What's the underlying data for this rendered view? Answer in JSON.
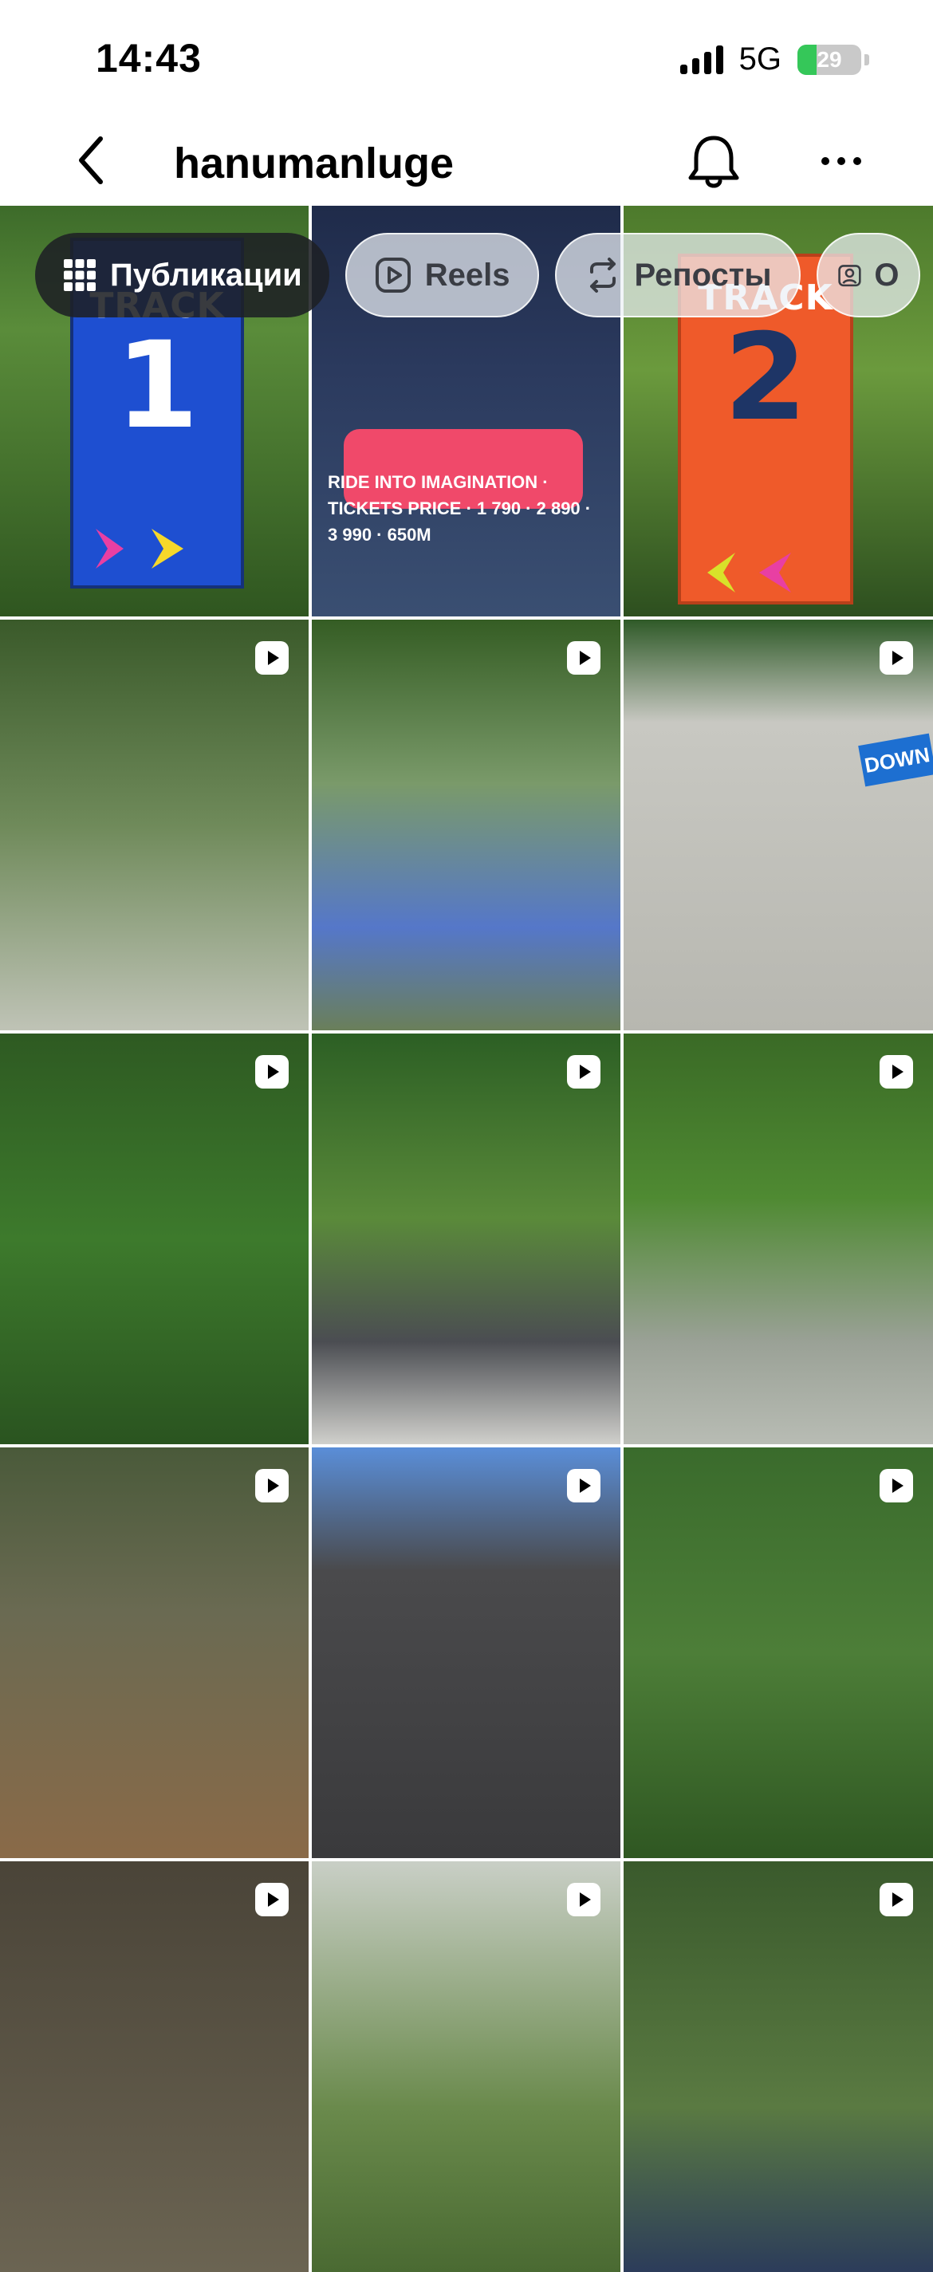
{
  "status_bar": {
    "time": "14:43",
    "network": "5G",
    "battery_percent": "29"
  },
  "nav": {
    "title": "hanumanluge",
    "back_icon": "chevron-left-icon",
    "bell_icon": "bell-icon",
    "more_icon": "ellipsis-icon"
  },
  "tabs": [
    {
      "label": "Публикации",
      "icon": "grid-icon",
      "active": true
    },
    {
      "label": "Reels",
      "icon": "reels-icon",
      "active": false
    },
    {
      "label": "Репосты",
      "icon": "repost-icon",
      "active": false
    },
    {
      "label": "О",
      "icon": "tagged-icon",
      "active": false
    }
  ],
  "tiles": [
    {
      "kind": "image",
      "text_word": "TRACK",
      "text_num": "1"
    },
    {
      "kind": "image",
      "text": "RIDE INTO IMAGINATION · TICKETS PRICE · 1 790 · 2 890 · 3 990 · 650M"
    },
    {
      "kind": "image",
      "text_word": "TRACK",
      "text_num": "2"
    },
    {
      "kind": "reel"
    },
    {
      "kind": "reel"
    },
    {
      "kind": "reel",
      "text": "DOWN"
    },
    {
      "kind": "reel"
    },
    {
      "kind": "reel"
    },
    {
      "kind": "reel"
    },
    {
      "kind": "reel"
    },
    {
      "kind": "reel"
    },
    {
      "kind": "reel"
    },
    {
      "kind": "reel"
    },
    {
      "kind": "reel"
    },
    {
      "kind": "reel"
    }
  ],
  "colors": {
    "accent_blue": "#1e4fd1",
    "accent_orange": "#ef5a2a",
    "battery_green": "#35c759"
  }
}
